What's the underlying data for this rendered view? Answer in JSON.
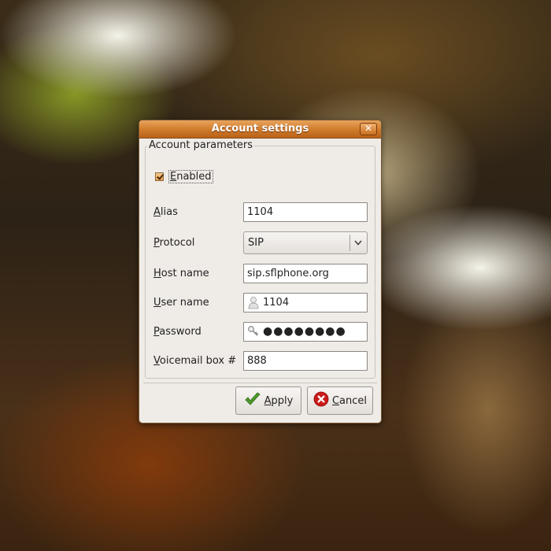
{
  "window": {
    "title": "Account settings",
    "close_glyph": "✕"
  },
  "frame": {
    "label": "Account parameters"
  },
  "enabled": {
    "label_u": "E",
    "label_rest": "nabled",
    "checked": true
  },
  "fields": {
    "alias": {
      "label_u": "A",
      "label_rest": "lias",
      "value": "1104"
    },
    "protocol": {
      "label_u": "P",
      "label_rest": "rotocol",
      "value": "SIP"
    },
    "host": {
      "label_u": "H",
      "label_rest": "ost name",
      "value": "sip.sflphone.org"
    },
    "user": {
      "label_u": "U",
      "label_rest": "ser name",
      "value": "1104",
      "icon": "user-icon"
    },
    "password": {
      "label_u": "P",
      "label_rest": "assword",
      "value": "●●●●●●●●",
      "icon": "key-icon"
    },
    "voicemail": {
      "label_u": "V",
      "label_rest": "oicemail box #",
      "value": "888"
    }
  },
  "buttons": {
    "apply": {
      "label_u": "A",
      "label_rest": "pply",
      "icon": "check-icon"
    },
    "cancel": {
      "label_u": "C",
      "label_rest": "ancel",
      "icon": "cancel-icon"
    }
  },
  "colors": {
    "title_bar": "#d07a2a",
    "dialog_bg": "#efebe7",
    "apply_green": "#4c9a2a",
    "cancel_red": "#cc1a1a"
  }
}
